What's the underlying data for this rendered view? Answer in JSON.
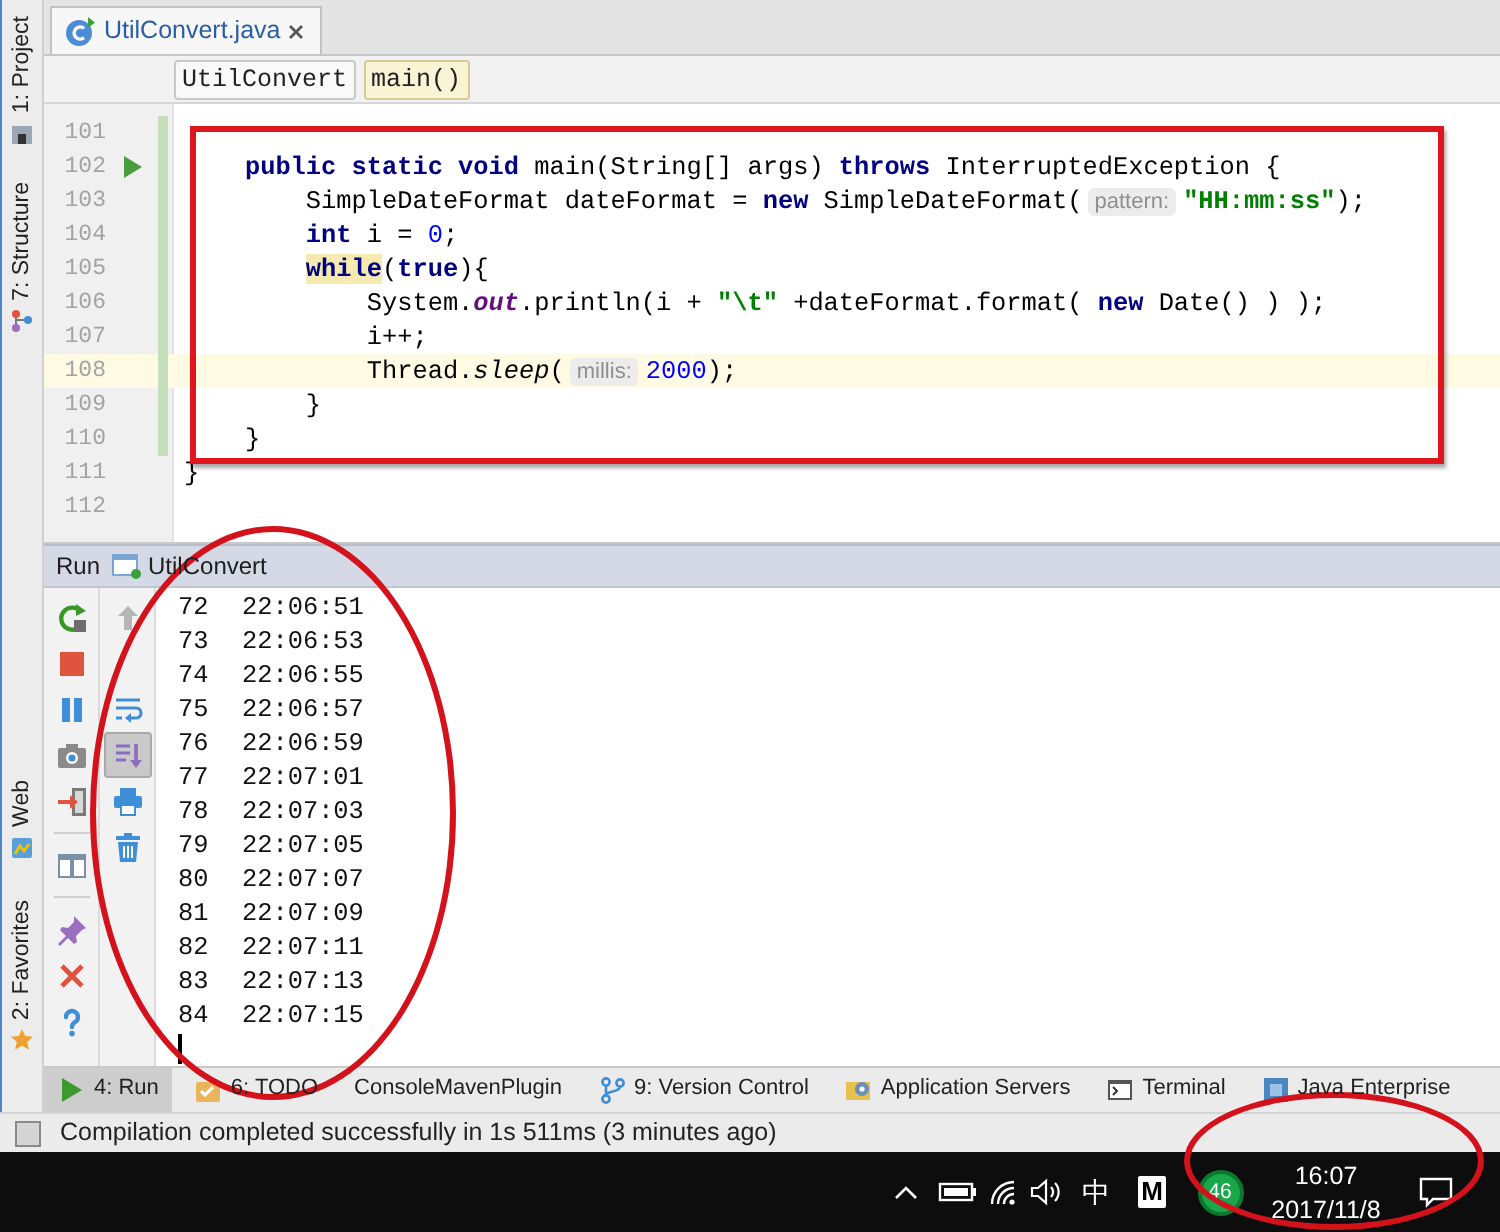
{
  "left_stripe": {
    "top": [
      {
        "kind": "project",
        "label": "1: Project"
      },
      {
        "kind": "structure",
        "label": "7: Structure"
      }
    ],
    "bottom": [
      {
        "kind": "web",
        "label": "Web"
      },
      {
        "kind": "favorites",
        "label": "2: Favorites"
      }
    ]
  },
  "editor_tabs": [
    {
      "title": "UtilConvert.java",
      "selected": true
    }
  ],
  "breadcrumbs": [
    {
      "label": "UtilConvert",
      "selected": false
    },
    {
      "label": "main()",
      "selected": true
    }
  ],
  "editor": {
    "outlined": true,
    "lines": [
      {
        "number": "101",
        "current": false,
        "changed": true,
        "run_marker": false
      },
      {
        "number": "102",
        "current": false,
        "changed": true,
        "run_marker": true,
        "code": [
          {
            "kind": "keyword",
            "text": "    public static void"
          },
          {
            "kind": "plain",
            "text": " main(String[] args) "
          },
          {
            "kind": "keyword",
            "text": "throws"
          },
          {
            "kind": "plain",
            "text": " InterruptedException {"
          }
        ]
      },
      {
        "number": "103",
        "current": false,
        "changed": true,
        "run_marker": false,
        "code": [
          {
            "kind": "plain",
            "text": "        SimpleDateFormat dateFormat = "
          },
          {
            "kind": "keyword",
            "text": "new"
          },
          {
            "kind": "plain",
            "text": " SimpleDateFormat("
          },
          {
            "kind": "hint",
            "text": "pattern:"
          },
          {
            "kind": "string",
            "text": "\"HH:mm:ss\""
          },
          {
            "kind": "plain",
            "text": ");"
          }
        ]
      },
      {
        "number": "104",
        "current": false,
        "changed": true,
        "run_marker": false,
        "code": [
          {
            "kind": "keyword",
            "text": "        int"
          },
          {
            "kind": "plain",
            "text": " i = "
          },
          {
            "kind": "number",
            "text": "0"
          },
          {
            "kind": "plain",
            "text": ";"
          }
        ]
      },
      {
        "number": "105",
        "current": false,
        "changed": true,
        "run_marker": false,
        "code": [
          {
            "kind": "keyword-marked",
            "text": "        while"
          },
          {
            "kind": "plain",
            "text": "("
          },
          {
            "kind": "keyword",
            "text": "true"
          },
          {
            "kind": "plain",
            "text": "){"
          }
        ]
      },
      {
        "number": "106",
        "current": false,
        "changed": true,
        "run_marker": false,
        "code": [
          {
            "kind": "plain",
            "text": "            System."
          },
          {
            "kind": "static-field",
            "text": "out"
          },
          {
            "kind": "plain",
            "text": ".println(i + "
          },
          {
            "kind": "string",
            "text": "\"\\t\""
          },
          {
            "kind": "plain",
            "text": " +dateFormat.format( "
          },
          {
            "kind": "keyword",
            "text": "new"
          },
          {
            "kind": "plain",
            "text": " Date() ) );"
          }
        ]
      },
      {
        "number": "107",
        "current": false,
        "changed": true,
        "run_marker": false,
        "code": [
          {
            "kind": "plain",
            "text": "            i++;"
          }
        ]
      },
      {
        "number": "108",
        "current": true,
        "changed": true,
        "run_marker": false,
        "code": [
          {
            "kind": "plain",
            "text": "            Thread."
          },
          {
            "kind": "static-call",
            "text": "sleep"
          },
          {
            "kind": "plain",
            "text": "("
          },
          {
            "kind": "hint",
            "text": "millis:"
          },
          {
            "kind": "number",
            "text": "2000"
          },
          {
            "kind": "plain",
            "text": ");"
          }
        ]
      },
      {
        "number": "109",
        "current": false,
        "changed": true,
        "run_marker": false,
        "code": [
          {
            "kind": "plain",
            "text": "        }"
          }
        ]
      },
      {
        "number": "110",
        "current": false,
        "changed": true,
        "run_marker": false,
        "code": [
          {
            "kind": "plain",
            "text": "    }"
          }
        ]
      },
      {
        "number": "111",
        "current": false,
        "changed": false,
        "run_marker": false,
        "code": [
          {
            "kind": "plain",
            "text": "}"
          }
        ]
      },
      {
        "number": "112",
        "current": false,
        "changed": false,
        "run_marker": false
      }
    ]
  },
  "run_panel": {
    "title": "Run",
    "tab": "UtilConvert",
    "console_toolbar": [
      {
        "kind": "up",
        "disabled": true,
        "toggled": false
      },
      {
        "kind": "wrap",
        "disabled": false,
        "toggled": false
      },
      {
        "kind": "scroll-end",
        "disabled": false,
        "toggled": true
      },
      {
        "kind": "print",
        "disabled": false,
        "toggled": false
      },
      {
        "kind": "clear",
        "disabled": false,
        "toggled": false
      }
    ],
    "output": {
      "circled": true,
      "caret": true,
      "lines": [
        {
          "number": "72",
          "time": "22:06:51"
        },
        {
          "number": "73",
          "time": "22:06:53"
        },
        {
          "number": "74",
          "time": "22:06:55"
        },
        {
          "number": "75",
          "time": "22:06:57"
        },
        {
          "number": "76",
          "time": "22:06:59"
        },
        {
          "number": "77",
          "time": "22:07:01"
        },
        {
          "number": "78",
          "time": "22:07:03"
        },
        {
          "number": "79",
          "time": "22:07:05"
        },
        {
          "number": "80",
          "time": "22:07:07"
        },
        {
          "number": "81",
          "time": "22:07:09"
        },
        {
          "number": "82",
          "time": "22:07:11"
        },
        {
          "number": "83",
          "time": "22:07:13"
        },
        {
          "number": "84",
          "time": "22:07:15"
        }
      ]
    }
  },
  "tool_window_bar": [
    {
      "kind": "run",
      "label": "4: Run",
      "selected": true
    },
    {
      "kind": "todo",
      "label": "6: TODO",
      "selected": false
    },
    {
      "kind": "plain",
      "label": "ConsoleMavenPlugin",
      "selected": false
    },
    {
      "kind": "vcs",
      "label": "9: Version Control",
      "selected": false
    },
    {
      "kind": "server",
      "label": "Application Servers",
      "selected": false
    },
    {
      "kind": "terminal",
      "label": "Terminal",
      "selected": false
    },
    {
      "kind": "enterprise",
      "label": "Java Enterprise",
      "selected": false
    }
  ],
  "status_bar": {
    "message": "Compilation completed successfully in 1s 511ms (3 minutes ago)"
  },
  "taskbar": {
    "circled": true,
    "input_method": "中",
    "app_letter": "M",
    "badge": "46",
    "time": "16:07",
    "date": "2017/11/8"
  }
}
